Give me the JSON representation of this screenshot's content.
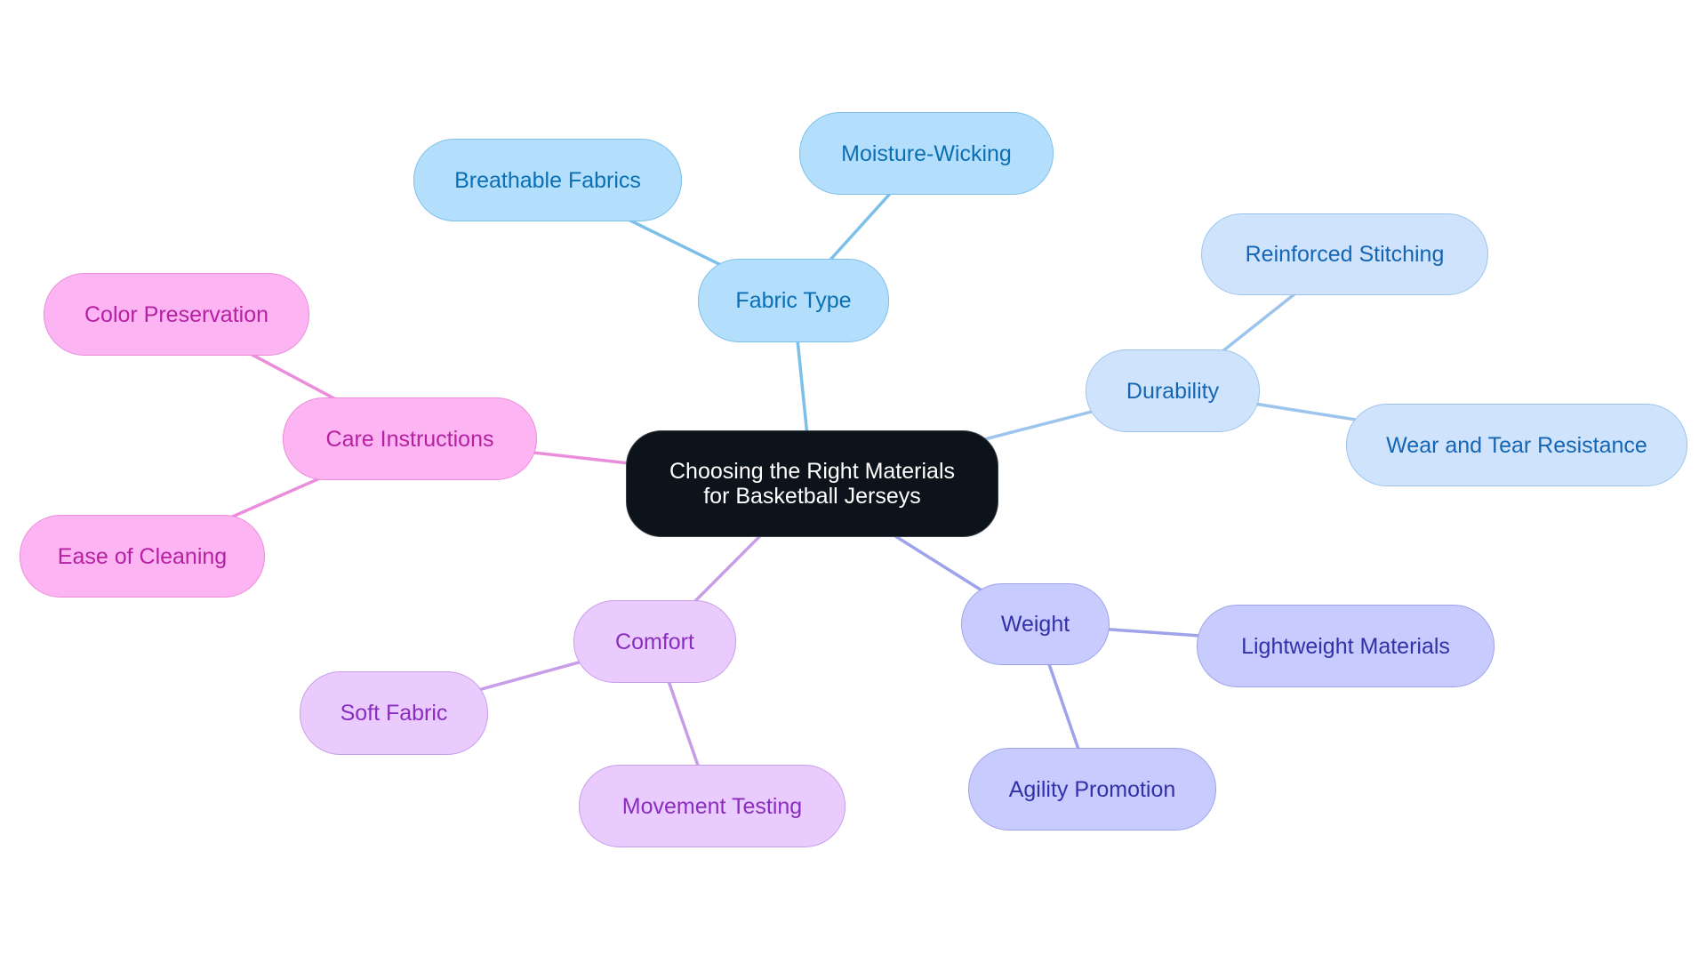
{
  "title": "Choosing the Right Materials for Basketball Jerseys",
  "central": {
    "line1": "Choosing the Right Materials",
    "line2": "for Basketball Jerseys"
  },
  "branches": [
    {
      "id": "fabric",
      "label": "Fabric Type",
      "colors": {
        "fill": "#b3dffc",
        "stroke": "#7cbfe8",
        "text": "#0b6fb3",
        "edge": "#7cbfe8"
      },
      "children": [
        {
          "id": "breathable",
          "label": "Breathable Fabrics"
        },
        {
          "id": "moisture",
          "label": "Moisture-Wicking"
        }
      ]
    },
    {
      "id": "durability",
      "label": "Durability",
      "colors": {
        "fill": "#cfe4fc",
        "stroke": "#9cc4ec",
        "text": "#1565b5",
        "edge": "#9cc4ec"
      },
      "children": [
        {
          "id": "stitching",
          "label": "Reinforced Stitching"
        },
        {
          "id": "weartear",
          "label": "Wear and Tear Resistance"
        }
      ]
    },
    {
      "id": "weight",
      "label": "Weight",
      "colors": {
        "fill": "#c8cbfd",
        "stroke": "#9ea2ea",
        "text": "#3630a8",
        "edge": "#9ea2ea"
      },
      "children": [
        {
          "id": "lightweight",
          "label": "Lightweight Materials"
        },
        {
          "id": "agility",
          "label": "Agility Promotion"
        }
      ]
    },
    {
      "id": "comfort",
      "label": "Comfort",
      "colors": {
        "fill": "#eacbfd",
        "stroke": "#c79de8",
        "text": "#8a2dbf",
        "edge": "#c79de8"
      },
      "children": [
        {
          "id": "soft",
          "label": "Soft Fabric"
        },
        {
          "id": "movement",
          "label": "Movement Testing"
        }
      ]
    },
    {
      "id": "care",
      "label": "Care Instructions",
      "colors": {
        "fill": "#fcb4f2",
        "stroke": "#eb8ddb",
        "text": "#b620a3",
        "edge": "#eb8ddb"
      },
      "children": [
        {
          "id": "colorpres",
          "label": "Color Preservation"
        },
        {
          "id": "cleaning",
          "label": "Ease of Cleaning"
        }
      ]
    }
  ]
}
